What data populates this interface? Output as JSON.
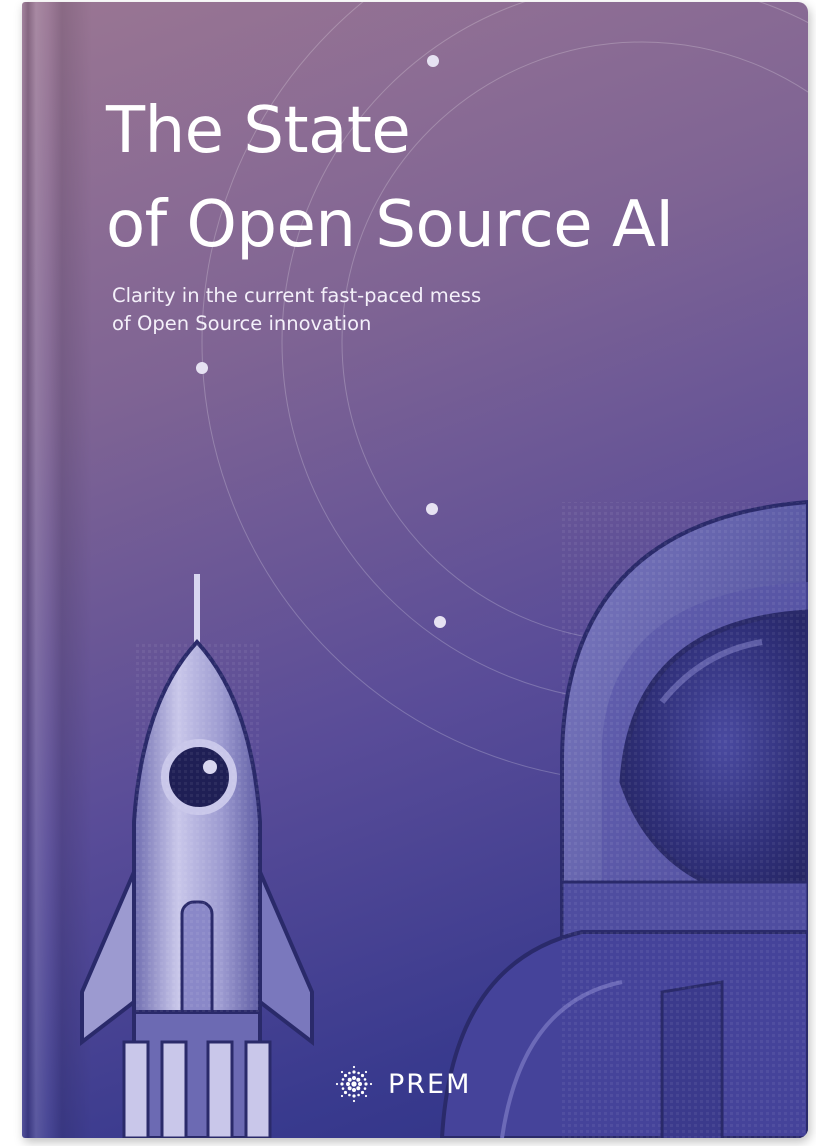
{
  "cover": {
    "title_line1": "The State",
    "title_line2": "of Open Source AI",
    "subtitle_line1": "Clarity in the current fast-paced mess",
    "subtitle_line2": "of Open Source innovation",
    "brand_name": "PREM"
  },
  "colors": {
    "gradient_top": "#9a7693",
    "gradient_mid": "#594c98",
    "gradient_bottom": "#2e3184",
    "title_text": "#ffffff",
    "illustration_light": "#c8c6e6",
    "illustration_dark": "#2a2a6a"
  },
  "icons": {
    "brand_logo": "prem-logo-icon",
    "rocket": "rocket-illustration",
    "astronaut": "astronaut-illustration"
  }
}
